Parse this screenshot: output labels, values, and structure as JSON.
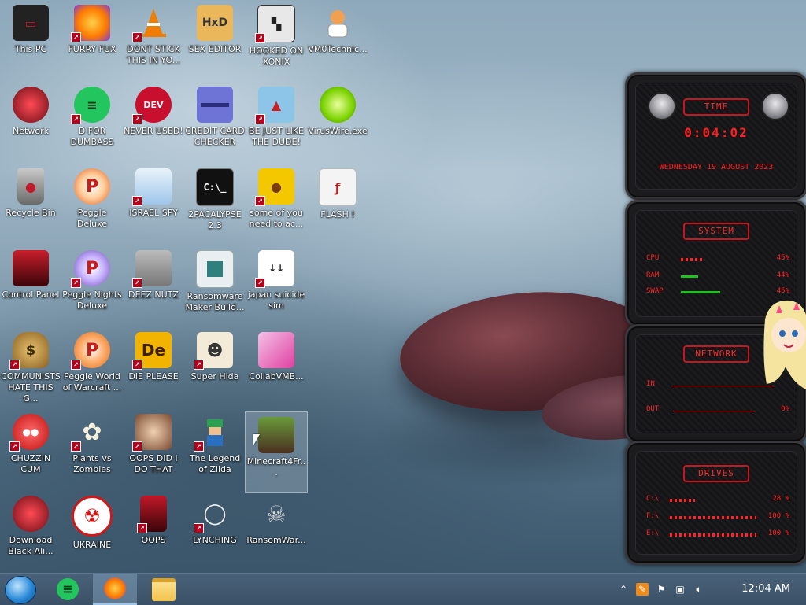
{
  "desktop": {
    "icons": [
      {
        "label": "This PC",
        "icon": "computer-icon",
        "color": "#c0192a"
      },
      {
        "label": "FURRY FUX",
        "icon": "firefox-icon",
        "color": "#ff7b00"
      },
      {
        "label": "DONT STICK THIS IN YO...",
        "icon": "traffic-cone-icon",
        "color": "#f07c00"
      },
      {
        "label": "SEX EDITOR",
        "icon": "hxd-editor-icon",
        "color": "#eab85a"
      },
      {
        "label": "HOOKED ON XONIX",
        "icon": "xonix-game-icon",
        "color": "#cfcfcf"
      },
      {
        "label": "VM0Technic...",
        "icon": "doctor-avatar-icon",
        "color": "#e7a050"
      },
      {
        "label": "Network",
        "icon": "network-orb-icon",
        "color": "#c81e2c"
      },
      {
        "label": "D FOR DUMBASS",
        "icon": "green-chat-icon",
        "color": "#22c55e"
      },
      {
        "label": "NEVER USED!",
        "icon": "dev-cpp-icon",
        "color": "#c8102e"
      },
      {
        "label": "CREDIT CARD CHECKER",
        "icon": "credit-card-icon",
        "color": "#5b5fc7"
      },
      {
        "label": "BE JUST LIKE THE DUDE!",
        "icon": "elf-icon",
        "color": "#8cc5e8"
      },
      {
        "label": "VirusWire.exe",
        "icon": "lime-icon",
        "color": "#7bd300"
      },
      {
        "label": "Recycle Bin",
        "icon": "recycle-bin-icon",
        "color": "#a7202a"
      },
      {
        "label": "Peggle Deluxe",
        "icon": "peggle-icon",
        "color": "#e05a1a"
      },
      {
        "label": "ISRAEL SPY",
        "icon": "network-spy-icon",
        "color": "#5aa0e0"
      },
      {
        "label": "2PACALYPSE 2.3",
        "icon": "terminal-icon",
        "color": "#1a1a1a"
      },
      {
        "label": "some of you need to ac...",
        "icon": "dog-icon",
        "color": "#f3c800"
      },
      {
        "label": "FLASH !",
        "icon": "flash-icon",
        "color": "#b22222"
      },
      {
        "label": "Control Panel",
        "icon": "control-panel-icon",
        "color": "#c81e2c"
      },
      {
        "label": "Peggle Nights Deluxe",
        "icon": "peggle-nights-icon",
        "color": "#6a4ab0"
      },
      {
        "label": "DEEZ NUTZ",
        "icon": "stack-icon",
        "color": "#888888"
      },
      {
        "label": "Ransomware Maker Build...",
        "icon": "ransomware-builder-icon",
        "color": "#cfd8dc"
      },
      {
        "label": "japan suicide sim",
        "icon": "japan-sim-icon",
        "color": "#ffffff"
      },
      {
        "label": "COMMUNISTS HATE THIS G...",
        "icon": "money-bag-icon",
        "color": "#c8a04a"
      },
      {
        "label": "Peggle World of Warcraft ...",
        "icon": "peggle-wow-icon",
        "color": "#d86a1a"
      },
      {
        "label": "DIE PLEASE",
        "icon": "de-icon",
        "color": "#f2b400"
      },
      {
        "label": "Super Hlda",
        "icon": "pixel-character-icon",
        "color": "#e0c080"
      },
      {
        "label": "CollabVMB...",
        "icon": "monitor-pink-icon",
        "color": "#e040a0"
      },
      {
        "label": "CHUZZIN CUM",
        "icon": "chuzzle-icon",
        "color": "#e02020"
      },
      {
        "label": "Plants vs Zombies",
        "icon": "flower-icon",
        "color": "#f0e6c8"
      },
      {
        "label": "OOPS DID I DO THAT",
        "icon": "portrait-icon",
        "color": "#a07050"
      },
      {
        "label": "The Legend of Zilda",
        "icon": "zilda-icon",
        "color": "#2aa050"
      },
      {
        "label": "Minecraft4Fr...",
        "icon": "minecraft-icon",
        "color": "#4a7a2a"
      },
      {
        "label": "Download Black Ali...",
        "icon": "alienware-orb-icon",
        "color": "#c81e2c"
      },
      {
        "label": "UKRAINE",
        "icon": "radiation-icon",
        "color": "#d01818"
      },
      {
        "label": "OOPS",
        "icon": "red-monitor-icon",
        "color": "#c01828"
      },
      {
        "label": "LYNCHING",
        "icon": "noose-icon",
        "color": "#dcdcdc"
      },
      {
        "label": "RansomWar...",
        "icon": "skull-icon",
        "color": "#aaaaaa"
      }
    ]
  },
  "gadgets": {
    "time": {
      "title": "TIME",
      "clock": "0:04:02",
      "date": "WEDNESDAY 19 AUGUST 2023"
    },
    "system": {
      "title": "SYSTEM",
      "rows": [
        {
          "key": "CPU",
          "value": "45%"
        },
        {
          "key": "RAM",
          "value": "44%"
        },
        {
          "key": "SWAP",
          "value": "45%"
        }
      ]
    },
    "network": {
      "title": "NETWORK",
      "rows": [
        {
          "key": "IN",
          "value": ""
        },
        {
          "key": "OUT",
          "value": "0%"
        }
      ]
    },
    "drives": {
      "title": "DRIVES",
      "rows": [
        {
          "key": "C:\\",
          "value": "28 %"
        },
        {
          "key": "F:\\",
          "value": "100 %"
        },
        {
          "key": "E:\\",
          "value": "100 %"
        }
      ]
    }
  },
  "taskbar": {
    "time": "12:04 AM",
    "pinned": [
      {
        "name": "green-chat-taskbar-icon",
        "color": "#22c55e"
      },
      {
        "name": "firefox-taskbar-icon",
        "color": "#ff7b00"
      },
      {
        "name": "file-explorer-taskbar-icon",
        "color": "#f2c24a"
      }
    ]
  },
  "colors": {
    "accent": "#ff2424",
    "taskbar": "#3f5870"
  }
}
